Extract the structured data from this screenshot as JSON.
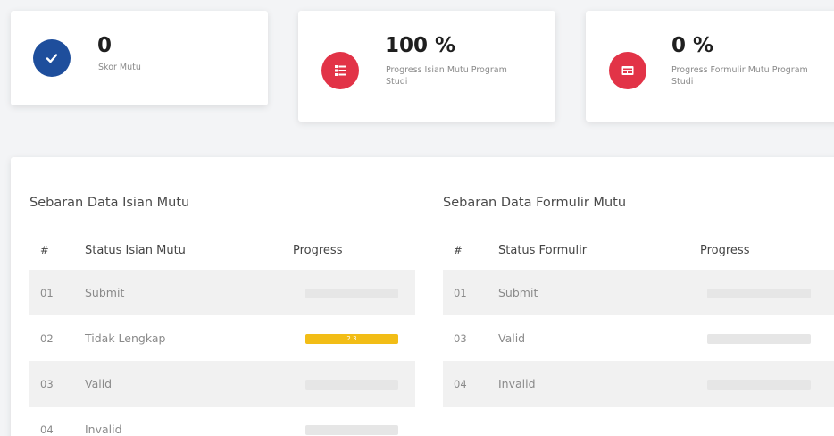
{
  "stats": [
    {
      "value": "0",
      "label": "Skor Mutu",
      "icon": "check-circle-icon",
      "color": "#1e4e9c"
    },
    {
      "value": "100 %",
      "label": "Progress Isian Mutu Program Studi",
      "icon": "list-icon",
      "color": "#e23347"
    },
    {
      "value": "0 %",
      "label": "Progress Formulir Mutu Program Studi",
      "icon": "form-icon",
      "color": "#e23347"
    }
  ],
  "isian": {
    "title": "Sebaran Data Isian Mutu",
    "headers": [
      "#",
      "Status Isian Mutu",
      "Progress"
    ],
    "rows": [
      {
        "num": "01",
        "status": "Submit",
        "progress": 0,
        "progress_label": ""
      },
      {
        "num": "02",
        "status": "Tidak Lengkap",
        "progress": 100,
        "progress_label": "2.3"
      },
      {
        "num": "03",
        "status": "Valid",
        "progress": 0,
        "progress_label": ""
      },
      {
        "num": "04",
        "status": "Invalid",
        "progress": 0,
        "progress_label": ""
      }
    ]
  },
  "formulir": {
    "title": "Sebaran Data Formulir Mutu",
    "headers": [
      "#",
      "Status Formulir",
      "Progress"
    ],
    "rows": [
      {
        "num": "01",
        "status": "Submit",
        "progress": 0,
        "progress_label": ""
      },
      {
        "num": "03",
        "status": "Valid",
        "progress": 0,
        "progress_label": ""
      },
      {
        "num": "04",
        "status": "Invalid",
        "progress": 0,
        "progress_label": ""
      }
    ]
  },
  "colors": {
    "accent_blue": "#1e4e9c",
    "accent_red": "#e23347",
    "progress_yellow": "#f2bd16"
  }
}
